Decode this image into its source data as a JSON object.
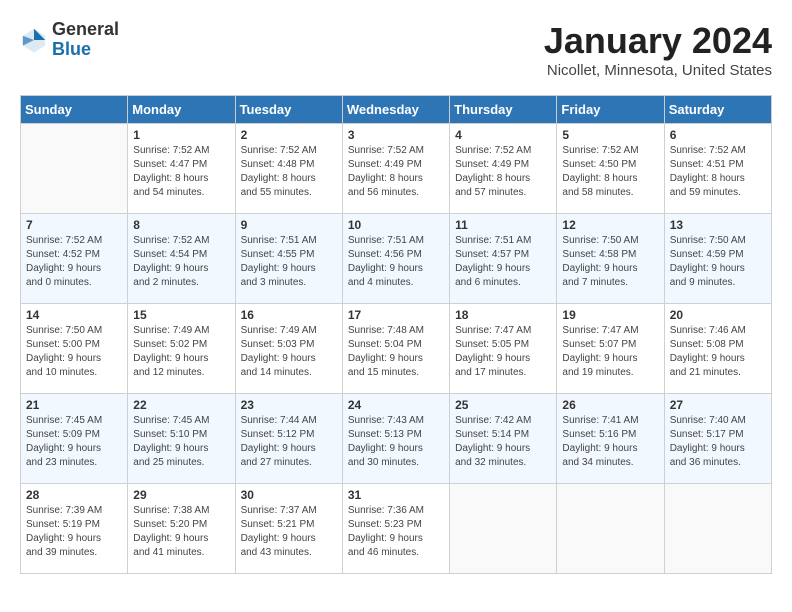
{
  "logo": {
    "general": "General",
    "blue": "Blue"
  },
  "title": "January 2024",
  "subtitle": "Nicollet, Minnesota, United States",
  "days_of_week": [
    "Sunday",
    "Monday",
    "Tuesday",
    "Wednesday",
    "Thursday",
    "Friday",
    "Saturday"
  ],
  "weeks": [
    [
      {
        "day": "",
        "content": ""
      },
      {
        "day": "1",
        "content": "Sunrise: 7:52 AM\nSunset: 4:47 PM\nDaylight: 8 hours\nand 54 minutes."
      },
      {
        "day": "2",
        "content": "Sunrise: 7:52 AM\nSunset: 4:48 PM\nDaylight: 8 hours\nand 55 minutes."
      },
      {
        "day": "3",
        "content": "Sunrise: 7:52 AM\nSunset: 4:49 PM\nDaylight: 8 hours\nand 56 minutes."
      },
      {
        "day": "4",
        "content": "Sunrise: 7:52 AM\nSunset: 4:49 PM\nDaylight: 8 hours\nand 57 minutes."
      },
      {
        "day": "5",
        "content": "Sunrise: 7:52 AM\nSunset: 4:50 PM\nDaylight: 8 hours\nand 58 minutes."
      },
      {
        "day": "6",
        "content": "Sunrise: 7:52 AM\nSunset: 4:51 PM\nDaylight: 8 hours\nand 59 minutes."
      }
    ],
    [
      {
        "day": "7",
        "content": "Sunrise: 7:52 AM\nSunset: 4:52 PM\nDaylight: 9 hours\nand 0 minutes."
      },
      {
        "day": "8",
        "content": "Sunrise: 7:52 AM\nSunset: 4:54 PM\nDaylight: 9 hours\nand 2 minutes."
      },
      {
        "day": "9",
        "content": "Sunrise: 7:51 AM\nSunset: 4:55 PM\nDaylight: 9 hours\nand 3 minutes."
      },
      {
        "day": "10",
        "content": "Sunrise: 7:51 AM\nSunset: 4:56 PM\nDaylight: 9 hours\nand 4 minutes."
      },
      {
        "day": "11",
        "content": "Sunrise: 7:51 AM\nSunset: 4:57 PM\nDaylight: 9 hours\nand 6 minutes."
      },
      {
        "day": "12",
        "content": "Sunrise: 7:50 AM\nSunset: 4:58 PM\nDaylight: 9 hours\nand 7 minutes."
      },
      {
        "day": "13",
        "content": "Sunrise: 7:50 AM\nSunset: 4:59 PM\nDaylight: 9 hours\nand 9 minutes."
      }
    ],
    [
      {
        "day": "14",
        "content": "Sunrise: 7:50 AM\nSunset: 5:00 PM\nDaylight: 9 hours\nand 10 minutes."
      },
      {
        "day": "15",
        "content": "Sunrise: 7:49 AM\nSunset: 5:02 PM\nDaylight: 9 hours\nand 12 minutes."
      },
      {
        "day": "16",
        "content": "Sunrise: 7:49 AM\nSunset: 5:03 PM\nDaylight: 9 hours\nand 14 minutes."
      },
      {
        "day": "17",
        "content": "Sunrise: 7:48 AM\nSunset: 5:04 PM\nDaylight: 9 hours\nand 15 minutes."
      },
      {
        "day": "18",
        "content": "Sunrise: 7:47 AM\nSunset: 5:05 PM\nDaylight: 9 hours\nand 17 minutes."
      },
      {
        "day": "19",
        "content": "Sunrise: 7:47 AM\nSunset: 5:07 PM\nDaylight: 9 hours\nand 19 minutes."
      },
      {
        "day": "20",
        "content": "Sunrise: 7:46 AM\nSunset: 5:08 PM\nDaylight: 9 hours\nand 21 minutes."
      }
    ],
    [
      {
        "day": "21",
        "content": "Sunrise: 7:45 AM\nSunset: 5:09 PM\nDaylight: 9 hours\nand 23 minutes."
      },
      {
        "day": "22",
        "content": "Sunrise: 7:45 AM\nSunset: 5:10 PM\nDaylight: 9 hours\nand 25 minutes."
      },
      {
        "day": "23",
        "content": "Sunrise: 7:44 AM\nSunset: 5:12 PM\nDaylight: 9 hours\nand 27 minutes."
      },
      {
        "day": "24",
        "content": "Sunrise: 7:43 AM\nSunset: 5:13 PM\nDaylight: 9 hours\nand 30 minutes."
      },
      {
        "day": "25",
        "content": "Sunrise: 7:42 AM\nSunset: 5:14 PM\nDaylight: 9 hours\nand 32 minutes."
      },
      {
        "day": "26",
        "content": "Sunrise: 7:41 AM\nSunset: 5:16 PM\nDaylight: 9 hours\nand 34 minutes."
      },
      {
        "day": "27",
        "content": "Sunrise: 7:40 AM\nSunset: 5:17 PM\nDaylight: 9 hours\nand 36 minutes."
      }
    ],
    [
      {
        "day": "28",
        "content": "Sunrise: 7:39 AM\nSunset: 5:19 PM\nDaylight: 9 hours\nand 39 minutes."
      },
      {
        "day": "29",
        "content": "Sunrise: 7:38 AM\nSunset: 5:20 PM\nDaylight: 9 hours\nand 41 minutes."
      },
      {
        "day": "30",
        "content": "Sunrise: 7:37 AM\nSunset: 5:21 PM\nDaylight: 9 hours\nand 43 minutes."
      },
      {
        "day": "31",
        "content": "Sunrise: 7:36 AM\nSunset: 5:23 PM\nDaylight: 9 hours\nand 46 minutes."
      },
      {
        "day": "",
        "content": ""
      },
      {
        "day": "",
        "content": ""
      },
      {
        "day": "",
        "content": ""
      }
    ]
  ]
}
